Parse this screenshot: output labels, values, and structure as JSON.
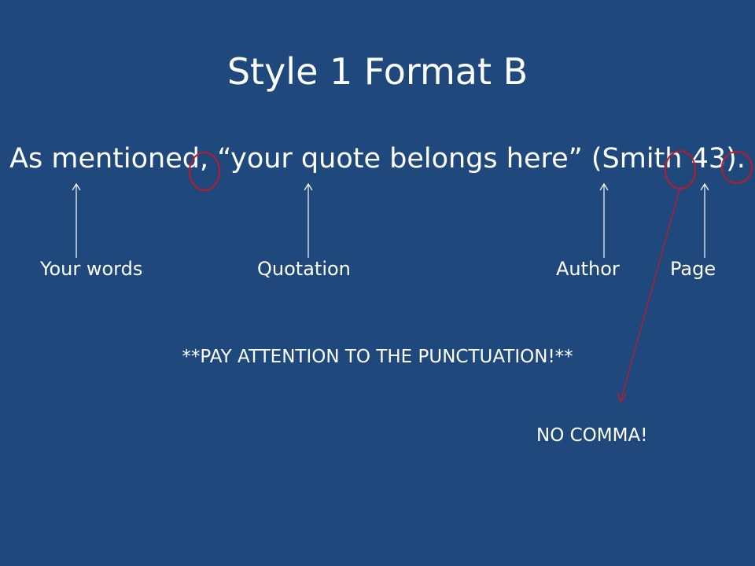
{
  "slide": {
    "title": "Style 1 Format B",
    "example_sentence": "As mentioned, “your quote belongs here” (Smith 43).",
    "labels": {
      "your_words": "Your words",
      "quotation": "Quotation",
      "author": "Author",
      "page": "Page"
    },
    "punctuation_note": "**PAY ATTENTION TO THE PUNCTUATION!**",
    "no_comma_note": "NO COMMA!",
    "colors": {
      "background": "#1F497D",
      "text": "#FFFFFF",
      "highlight": "#C0182B"
    }
  }
}
